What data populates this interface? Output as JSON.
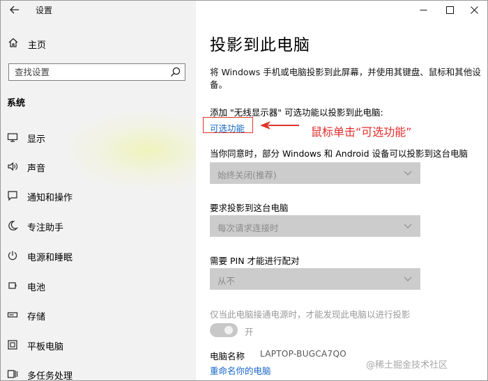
{
  "window": {
    "title": "设置",
    "back_icon": "back-arrow-icon",
    "controls": [
      "minimize-icon",
      "maximize-icon",
      "close-icon"
    ]
  },
  "sidebar": {
    "home_label": "主页",
    "search_placeholder": "查找设置",
    "section_title": "系统",
    "items": [
      {
        "label": "显示",
        "icon": "display-icon"
      },
      {
        "label": "声音",
        "icon": "sound-icon"
      },
      {
        "label": "通知和操作",
        "icon": "notification-icon"
      },
      {
        "label": "专注助手",
        "icon": "moon-icon"
      },
      {
        "label": "电源和睡眠",
        "icon": "power-icon"
      },
      {
        "label": "电池",
        "icon": "battery-icon"
      },
      {
        "label": "存储",
        "icon": "storage-icon"
      },
      {
        "label": "平板电脑",
        "icon": "tablet-icon"
      },
      {
        "label": "多任务处理",
        "icon": "multitask-icon"
      }
    ]
  },
  "main": {
    "title": "投影到此电脑",
    "description": "将 Windows 手机或电脑投影到此屏幕，并使用其键盘、鼠标和其他设备。",
    "add_display_label": "添加 \"无线显示器\" 可选功能以投影到此电脑:",
    "optional_features_link": "可选功能",
    "annotation": "鼠标单击“可选功能”",
    "allow_label": "当你同意时，部分 Windows 和 Android 设备可以投影到这台电脑",
    "allow_value": "始终关闭(推荐)",
    "request_label": "要求投影到这台电脑",
    "request_value": "每次请求连接时",
    "pin_label": "需要 PIN 才能进行配对",
    "pin_value": "从不",
    "power_hint": "仅当此电脑接通电源时，才能发现此电脑以进行投影",
    "toggle_label": "开",
    "toggle_on": true,
    "pc_name_label": "电脑名称",
    "pc_name_value": "LAPTOP-BUGCA7QO",
    "rename_link": "重命名你的电脑",
    "watermark": "@稀土掘金技术社区"
  },
  "colors": {
    "accent_link": "#1565c8",
    "annotation_red": "#e32b2b",
    "sidebar_bg": "#f2f2f2",
    "disabled_select_bg": "#cccccc"
  }
}
